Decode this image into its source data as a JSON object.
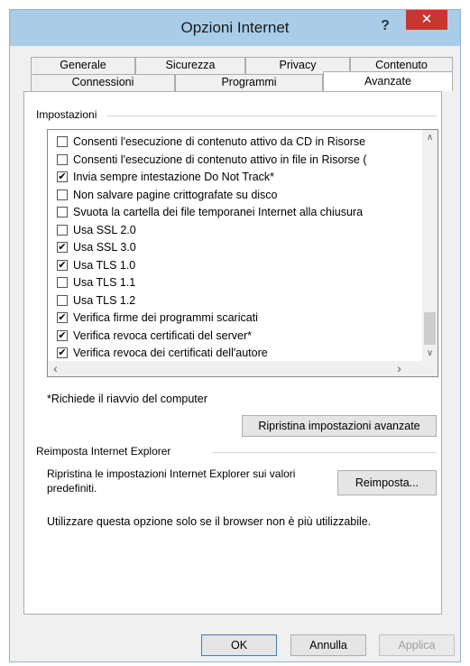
{
  "window": {
    "title": "Opzioni Internet",
    "help": "?",
    "close": "✕"
  },
  "tabs_row1": [
    "Generale",
    "Sicurezza",
    "Privacy",
    "Contenuto"
  ],
  "tabs_row2": [
    "Connessioni",
    "Programmi",
    "Avanzate"
  ],
  "settings": {
    "group_label": "Impostazioni",
    "items": [
      {
        "label": "Consenti l'esecuzione di contenuto attivo da CD in Risorse",
        "checked": false
      },
      {
        "label": "Consenti l'esecuzione di contenuto attivo in file in Risorse (",
        "checked": false
      },
      {
        "label": "Invia sempre intestazione Do Not Track*",
        "checked": true
      },
      {
        "label": "Non salvare pagine crittografate su disco",
        "checked": false
      },
      {
        "label": "Svuota la cartella dei file temporanei Internet alla chiusura",
        "checked": false
      },
      {
        "label": "Usa SSL 2.0",
        "checked": false
      },
      {
        "label": "Usa SSL 3.0",
        "checked": true
      },
      {
        "label": "Usa TLS 1.0",
        "checked": true
      },
      {
        "label": "Usa TLS 1.1",
        "checked": false
      },
      {
        "label": "Usa TLS 1.2",
        "checked": false
      },
      {
        "label": "Verifica firme dei programmi scaricati",
        "checked": true
      },
      {
        "label": "Verifica revoca certificati del server*",
        "checked": true
      },
      {
        "label": "Verifica revoca dei certificati dell'autore",
        "checked": true
      }
    ],
    "restart_note": "*Richiede il riavvio del computer",
    "restore_button": "Ripristina impostazioni avanzate"
  },
  "reset": {
    "group_label": "Reimposta Internet Explorer",
    "description_line1": "Ripristina le impostazioni Internet Explorer sui valori",
    "description_line2": "predefiniti.",
    "button": "Reimposta...",
    "note": "Utilizzare questa opzione solo se il browser non è più utilizzabile."
  },
  "footer": {
    "ok": "OK",
    "cancel": "Annulla",
    "apply": "Applica"
  },
  "icons": {
    "check": "✔",
    "scroll_up": "∧",
    "scroll_down": "∨",
    "scroll_left": "‹",
    "scroll_right": "›"
  }
}
